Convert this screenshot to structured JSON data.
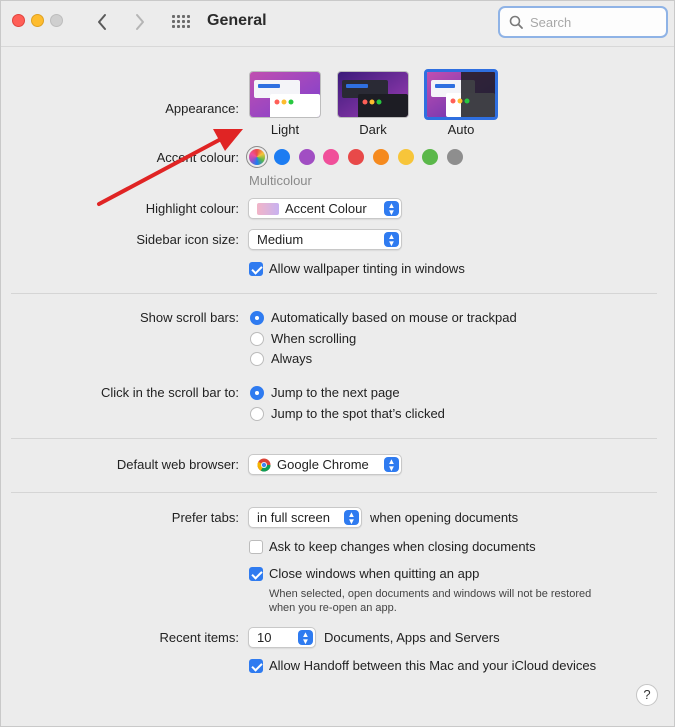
{
  "window": {
    "title": "General",
    "search_placeholder": "Search"
  },
  "appearance": {
    "label": "Appearance:",
    "options": [
      "Light",
      "Dark",
      "Auto"
    ],
    "selected": "Auto"
  },
  "accent": {
    "label": "Accent colour:",
    "caption": "Multicolour",
    "colors": [
      "multicolour",
      "#1c7cf2",
      "#a14ec3",
      "#f04f9a",
      "#e84949",
      "#f58a1f",
      "#f7c53a",
      "#5bb84a",
      "#8e8e8e"
    ]
  },
  "highlight": {
    "label": "Highlight colour:",
    "value": "Accent Colour"
  },
  "sidebar_icon": {
    "label": "Sidebar icon size:",
    "value": "Medium"
  },
  "wallpaper_tint": {
    "label": "Allow wallpaper tinting in windows",
    "checked": true
  },
  "scroll_bars": {
    "label": "Show scroll bars:",
    "options": [
      "Automatically based on mouse or trackpad",
      "When scrolling",
      "Always"
    ],
    "selected": 0
  },
  "click_scroll": {
    "label": "Click in the scroll bar to:",
    "options": [
      "Jump to the next page",
      "Jump to the spot that’s clicked"
    ],
    "selected": 0
  },
  "browser": {
    "label": "Default web browser:",
    "value": "Google Chrome"
  },
  "prefer_tabs": {
    "label": "Prefer tabs:",
    "value": "in full screen",
    "suffix": "when opening documents"
  },
  "ask_keep": {
    "label": "Ask to keep changes when closing documents",
    "checked": false
  },
  "close_windows": {
    "label": "Close windows when quitting an app",
    "checked": true,
    "note_line1": "When selected, open documents and windows will not be restored",
    "note_line2": "when you re-open an app."
  },
  "recent_items": {
    "label": "Recent items:",
    "value": "10",
    "suffix": "Documents, Apps and Servers"
  },
  "handoff": {
    "label": "Allow Handoff between this Mac and your iCloud devices",
    "checked": true
  },
  "help": "?",
  "annotation": {
    "arrow_color": "#e02424"
  }
}
